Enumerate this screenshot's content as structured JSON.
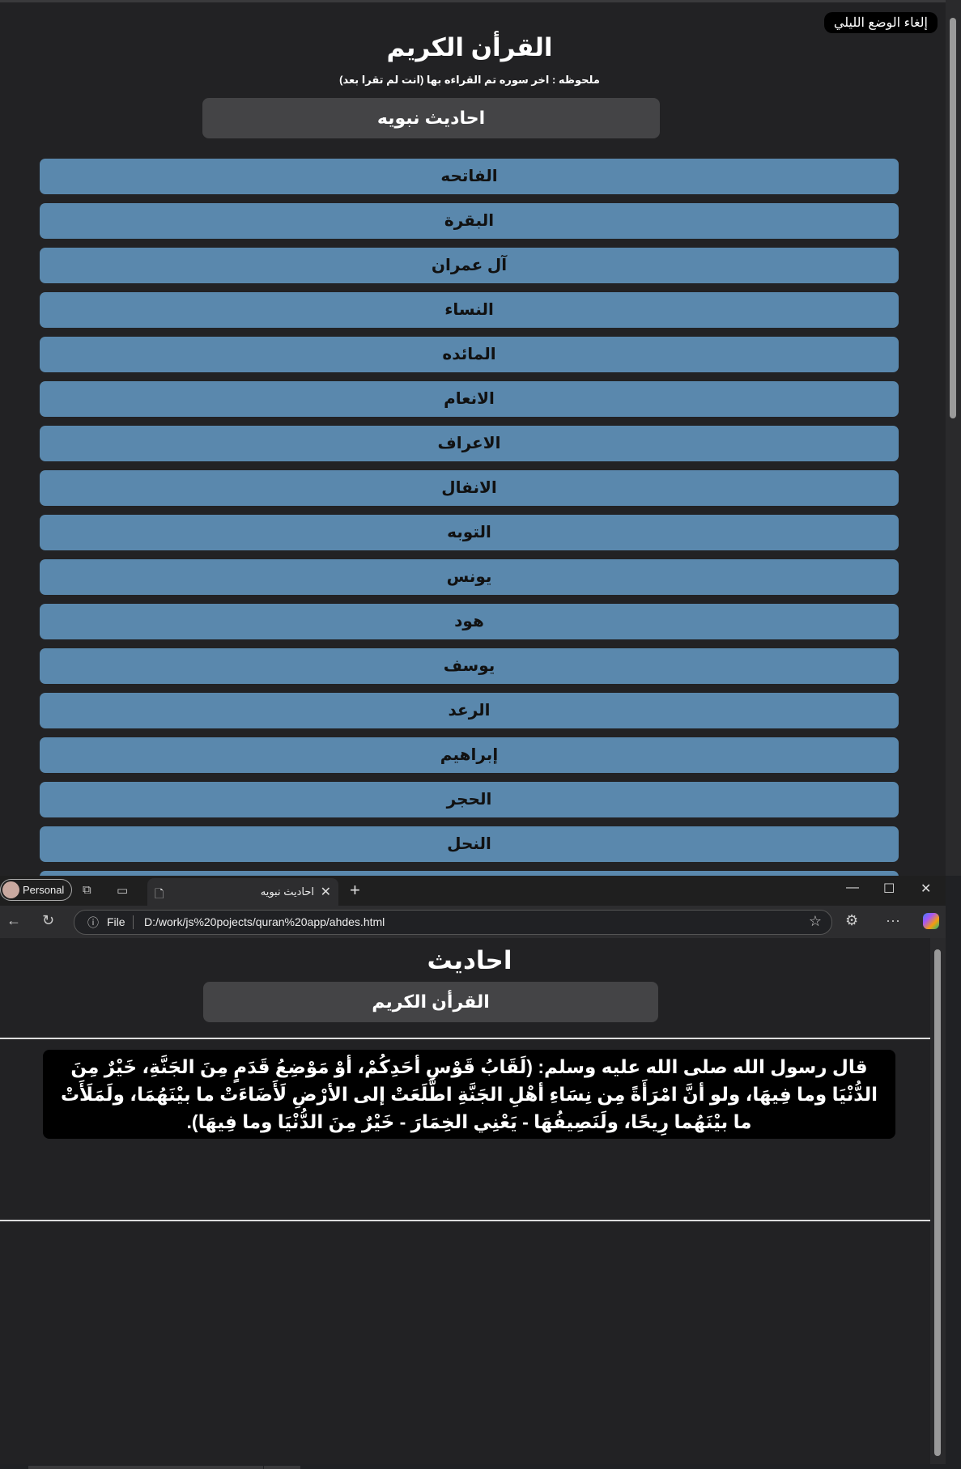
{
  "page1": {
    "dark_mode_button": "إلغاء الوضع الليلي",
    "title": "القرأن الكريم",
    "note": "ملحوظه : اخر سوره تم القراءه بها (انت لم تقرا بعد)",
    "nav_button": "احاديث نبويه",
    "surahs": [
      "الفاتحه",
      "البقرة",
      "آل عمران",
      "النساء",
      "المائده",
      "الانعام",
      "الاعراف",
      "الانفال",
      "التوبه",
      "يونس",
      "هود",
      "يوسف",
      "الرعد",
      "إبراهيم",
      "الحجر",
      "النحل"
    ]
  },
  "browser": {
    "profile_label": "Personal",
    "tab_title": "احاديث نبويه",
    "address_scheme": "File",
    "address_url": "D:/work/js%20pojects/quran%20app/ahdes.html"
  },
  "page2": {
    "title": "احاديث",
    "nav_button": "القرأن الكريم",
    "hadith": "قال رسول الله صلى الله عليه وسلم: (لَقَابُ قَوْسِ أحَدِكُمْ، أوْ مَوْضِعُ قَدَمٍ مِنَ الجَنَّةِ، خَيْرٌ مِنَ الدُّنْيَا وما فِيهَا، ولو أنَّ امْرَأَةً مِن نِسَاءِ أهْلِ الجَنَّةِ اطَّلَعَتْ إلى الأرْضِ لَأَضَاءَتْ ما بيْنَهُمَا، ولَمَلَأَتْ ما بيْنَهُما رِيحًا، ولَنَصِيفُهَا - يَعْنِي الخِمَارَ - خَيْرٌ مِنَ الدُّنْيَا وما فِيهَا)."
  }
}
